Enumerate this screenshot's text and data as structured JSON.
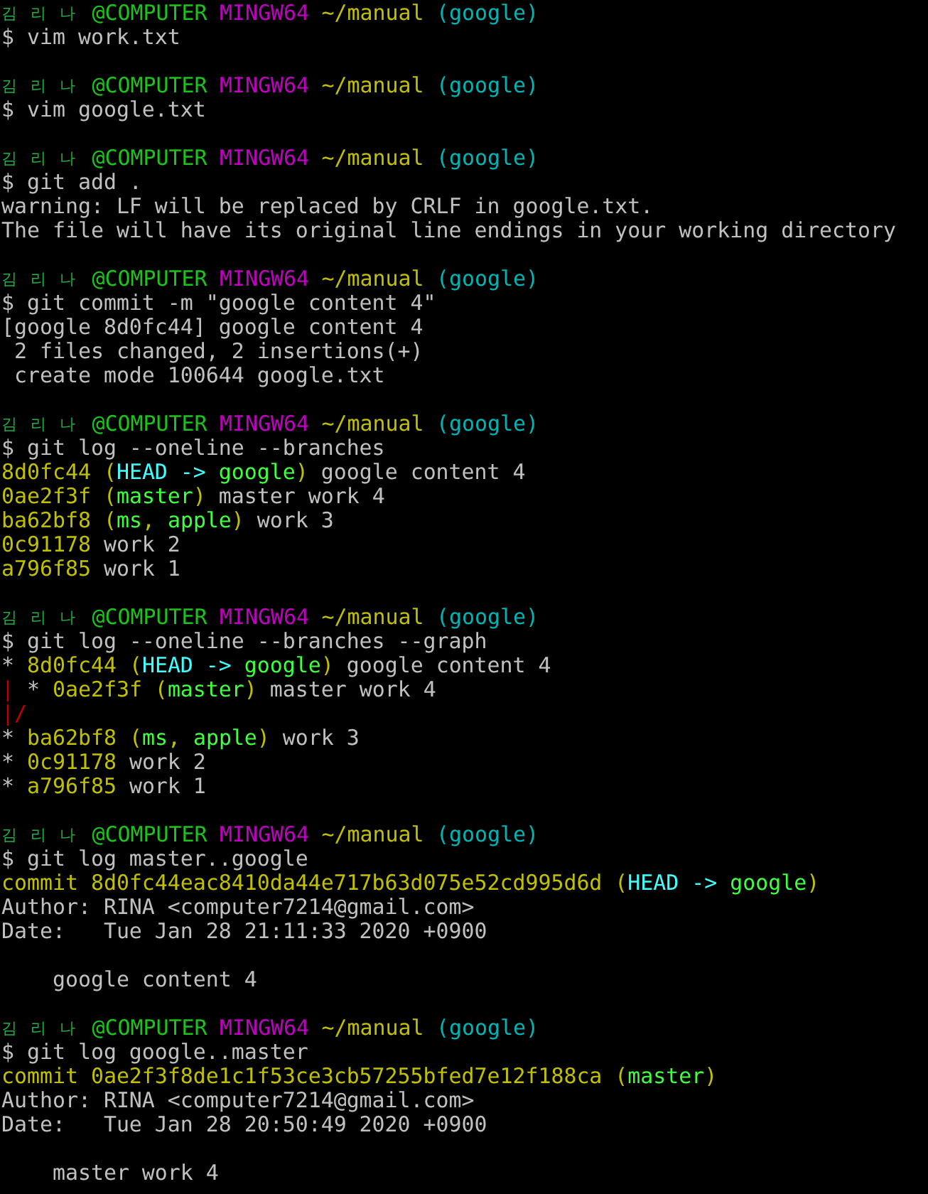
{
  "blocks": [
    {
      "prompt": [
        {
          "text": "김 리 나",
          "color": "#1bb33a"
        },
        {
          "text": "@COMPUTER",
          "color": "#1bc31b"
        },
        {
          "text": "MINGW64",
          "color": "#c000c0"
        },
        {
          "text": "~/manual",
          "color": "#c0c000"
        },
        {
          "text": "(google)",
          "color": "#00b4b4"
        }
      ],
      "command": "$ vim work.txt"
    },
    {
      "prompt": [
        {
          "text": "김 리 나",
          "color": "#1bb33a"
        },
        {
          "text": "@COMPUTER",
          "color": "#1bc31b"
        },
        {
          "text": "MINGW64",
          "color": "#c000c0"
        },
        {
          "text": "~/manual",
          "color": "#c0c000"
        },
        {
          "text": "(google)",
          "color": "#00b4b4"
        }
      ],
      "command": "$ vim google.txt"
    },
    {
      "prompt": [
        {
          "text": "김 리 나",
          "color": "#1bb33a"
        },
        {
          "text": "@COMPUTER",
          "color": "#1bc31b"
        },
        {
          "text": "MINGW64",
          "color": "#c000c0"
        },
        {
          "text": "~/manual",
          "color": "#c0c000"
        },
        {
          "text": "(google)",
          "color": "#00b4b4"
        }
      ],
      "command": "$ git add .",
      "output": [
        {
          "kind": "text",
          "segments": [
            {
              "text": "warning: LF will be replaced by CRLF in google.txt.",
              "color": "#c0c0c0"
            }
          ]
        },
        {
          "kind": "text",
          "segments": [
            {
              "text": "The file will have its original line endings in your working directory",
              "color": "#c0c0c0"
            }
          ]
        }
      ]
    },
    {
      "prompt": [
        {
          "text": "김 리 나",
          "color": "#1bb33a"
        },
        {
          "text": "@COMPUTER",
          "color": "#1bc31b"
        },
        {
          "text": "MINGW64",
          "color": "#c000c0"
        },
        {
          "text": "~/manual",
          "color": "#c0c000"
        },
        {
          "text": "(google)",
          "color": "#00b4b4"
        }
      ],
      "command": "$ git commit -m \"google content 4\"",
      "output": [
        {
          "kind": "text",
          "segments": [
            {
              "text": "[google 8d0fc44] google content 4",
              "color": "#c0c0c0"
            }
          ]
        },
        {
          "kind": "text",
          "segments": [
            {
              "text": " 2 files changed, 2 insertions(+)",
              "color": "#c0c0c0"
            }
          ]
        },
        {
          "kind": "text",
          "segments": [
            {
              "text": " create mode 100644 google.txt",
              "color": "#c0c0c0"
            }
          ]
        }
      ]
    },
    {
      "prompt": [
        {
          "text": "김 리 나",
          "color": "#1bb33a"
        },
        {
          "text": "@COMPUTER",
          "color": "#1bc31b"
        },
        {
          "text": "MINGW64",
          "color": "#c000c0"
        },
        {
          "text": "~/manual",
          "color": "#c0c000"
        },
        {
          "text": "(google)",
          "color": "#00b4b4"
        }
      ],
      "command": "$ git log --oneline --branches",
      "output": [
        {
          "kind": "text",
          "segments": [
            {
              "text": "8d0fc44 (",
              "color": "#c0c000"
            },
            {
              "text": "HEAD -> ",
              "color": "#40ffff"
            },
            {
              "text": "google",
              "color": "#40ff40"
            },
            {
              "text": ")",
              "color": "#c0c000"
            },
            {
              "text": " google content 4",
              "color": "#c0c0c0"
            }
          ]
        },
        {
          "kind": "text",
          "segments": [
            {
              "text": "0ae2f3f (",
              "color": "#c0c000"
            },
            {
              "text": "master",
              "color": "#40ff40"
            },
            {
              "text": ")",
              "color": "#c0c000"
            },
            {
              "text": " master work 4",
              "color": "#c0c0c0"
            }
          ]
        },
        {
          "kind": "text",
          "segments": [
            {
              "text": "ba62bf8 (",
              "color": "#c0c000"
            },
            {
              "text": "ms",
              "color": "#40ff40"
            },
            {
              "text": ", ",
              "color": "#c0c000"
            },
            {
              "text": "apple",
              "color": "#40ff40"
            },
            {
              "text": ")",
              "color": "#c0c000"
            },
            {
              "text": " work 3",
              "color": "#c0c0c0"
            }
          ]
        },
        {
          "kind": "text",
          "segments": [
            {
              "text": "0c91178",
              "color": "#c0c000"
            },
            {
              "text": " work 2",
              "color": "#c0c0c0"
            }
          ]
        },
        {
          "kind": "text",
          "segments": [
            {
              "text": "a796f85",
              "color": "#c0c000"
            },
            {
              "text": " work 1",
              "color": "#c0c0c0"
            }
          ]
        }
      ]
    },
    {
      "prompt": [
        {
          "text": "김 리 나",
          "color": "#1bb33a"
        },
        {
          "text": "@COMPUTER",
          "color": "#1bc31b"
        },
        {
          "text": "MINGW64",
          "color": "#c000c0"
        },
        {
          "text": "~/manual",
          "color": "#c0c000"
        },
        {
          "text": "(google)",
          "color": "#00b4b4"
        }
      ],
      "command": "$ git log --oneline --branches --graph",
      "output": [
        {
          "kind": "text",
          "segments": [
            {
              "text": "* ",
              "color": "#c0c0c0"
            },
            {
              "text": "8d0fc44 (",
              "color": "#c0c000"
            },
            {
              "text": "HEAD -> ",
              "color": "#40ffff"
            },
            {
              "text": "google",
              "color": "#40ff40"
            },
            {
              "text": ")",
              "color": "#c0c000"
            },
            {
              "text": " google content 4",
              "color": "#c0c0c0"
            }
          ]
        },
        {
          "kind": "text",
          "segments": [
            {
              "text": "|",
              "color": "#c00000"
            },
            {
              "text": " * ",
              "color": "#c0c0c0"
            },
            {
              "text": "0ae2f3f (",
              "color": "#c0c000"
            },
            {
              "text": "master",
              "color": "#40ff40"
            },
            {
              "text": ")",
              "color": "#c0c000"
            },
            {
              "text": " master work 4",
              "color": "#c0c0c0"
            }
          ]
        },
        {
          "kind": "text",
          "segments": [
            {
              "text": "|/",
              "color": "#c00000"
            }
          ]
        },
        {
          "kind": "text",
          "segments": [
            {
              "text": "* ",
              "color": "#c0c0c0"
            },
            {
              "text": "ba62bf8 (",
              "color": "#c0c000"
            },
            {
              "text": "ms",
              "color": "#40ff40"
            },
            {
              "text": ", ",
              "color": "#c0c000"
            },
            {
              "text": "apple",
              "color": "#40ff40"
            },
            {
              "text": ")",
              "color": "#c0c000"
            },
            {
              "text": " work 3",
              "color": "#c0c0c0"
            }
          ]
        },
        {
          "kind": "text",
          "segments": [
            {
              "text": "* ",
              "color": "#c0c0c0"
            },
            {
              "text": "0c91178",
              "color": "#c0c000"
            },
            {
              "text": " work 2",
              "color": "#c0c0c0"
            }
          ]
        },
        {
          "kind": "text",
          "segments": [
            {
              "text": "* ",
              "color": "#c0c0c0"
            },
            {
              "text": "a796f85",
              "color": "#c0c000"
            },
            {
              "text": " work 1",
              "color": "#c0c0c0"
            }
          ]
        }
      ]
    },
    {
      "prompt": [
        {
          "text": "김 리 나",
          "color": "#1bb33a"
        },
        {
          "text": "@COMPUTER",
          "color": "#1bc31b"
        },
        {
          "text": "MINGW64",
          "color": "#c000c0"
        },
        {
          "text": "~/manual",
          "color": "#c0c000"
        },
        {
          "text": "(google)",
          "color": "#00b4b4"
        }
      ],
      "command": "$ git log master..google",
      "output": [
        {
          "kind": "text",
          "segments": [
            {
              "text": "commit 8d0fc44eac8410da44e717b63d075e52cd995d6d (",
              "color": "#c0c000"
            },
            {
              "text": "HEAD -> ",
              "color": "#40ffff"
            },
            {
              "text": "google",
              "color": "#40ff40"
            },
            {
              "text": ")",
              "color": "#c0c000"
            }
          ]
        },
        {
          "kind": "text",
          "segments": [
            {
              "text": "Author: RINA <computer7214@gmail.com>",
              "color": "#c0c0c0"
            }
          ]
        },
        {
          "kind": "text",
          "segments": [
            {
              "text": "Date:   Tue Jan 28 21:11:33 2020 +0900",
              "color": "#c0c0c0"
            }
          ]
        },
        {
          "kind": "message",
          "segments": [
            {
              "text": "    google content 4",
              "color": "#c0c0c0"
            }
          ]
        }
      ]
    },
    {
      "prompt": [
        {
          "text": "김 리 나",
          "color": "#1bb33a"
        },
        {
          "text": "@COMPUTER",
          "color": "#1bc31b"
        },
        {
          "text": "MINGW64",
          "color": "#c000c0"
        },
        {
          "text": "~/manual",
          "color": "#c0c000"
        },
        {
          "text": "(google)",
          "color": "#00b4b4"
        }
      ],
      "command": "$ git log google..master",
      "output": [
        {
          "kind": "text",
          "segments": [
            {
              "text": "commit 0ae2f3f8de1c1f53ce3cb57255bfed7e12f188ca (",
              "color": "#c0c000"
            },
            {
              "text": "master",
              "color": "#40ff40"
            },
            {
              "text": ")",
              "color": "#c0c000"
            }
          ]
        },
        {
          "kind": "text",
          "segments": [
            {
              "text": "Author: RINA <computer7214@gmail.com>",
              "color": "#c0c0c0"
            }
          ]
        },
        {
          "kind": "text",
          "segments": [
            {
              "text": "Date:   Tue Jan 28 20:50:49 2020 +0900",
              "color": "#c0c0c0"
            }
          ]
        },
        {
          "kind": "message",
          "segments": [
            {
              "text": "    master work 4",
              "color": "#c0c0c0"
            }
          ]
        }
      ]
    }
  ]
}
